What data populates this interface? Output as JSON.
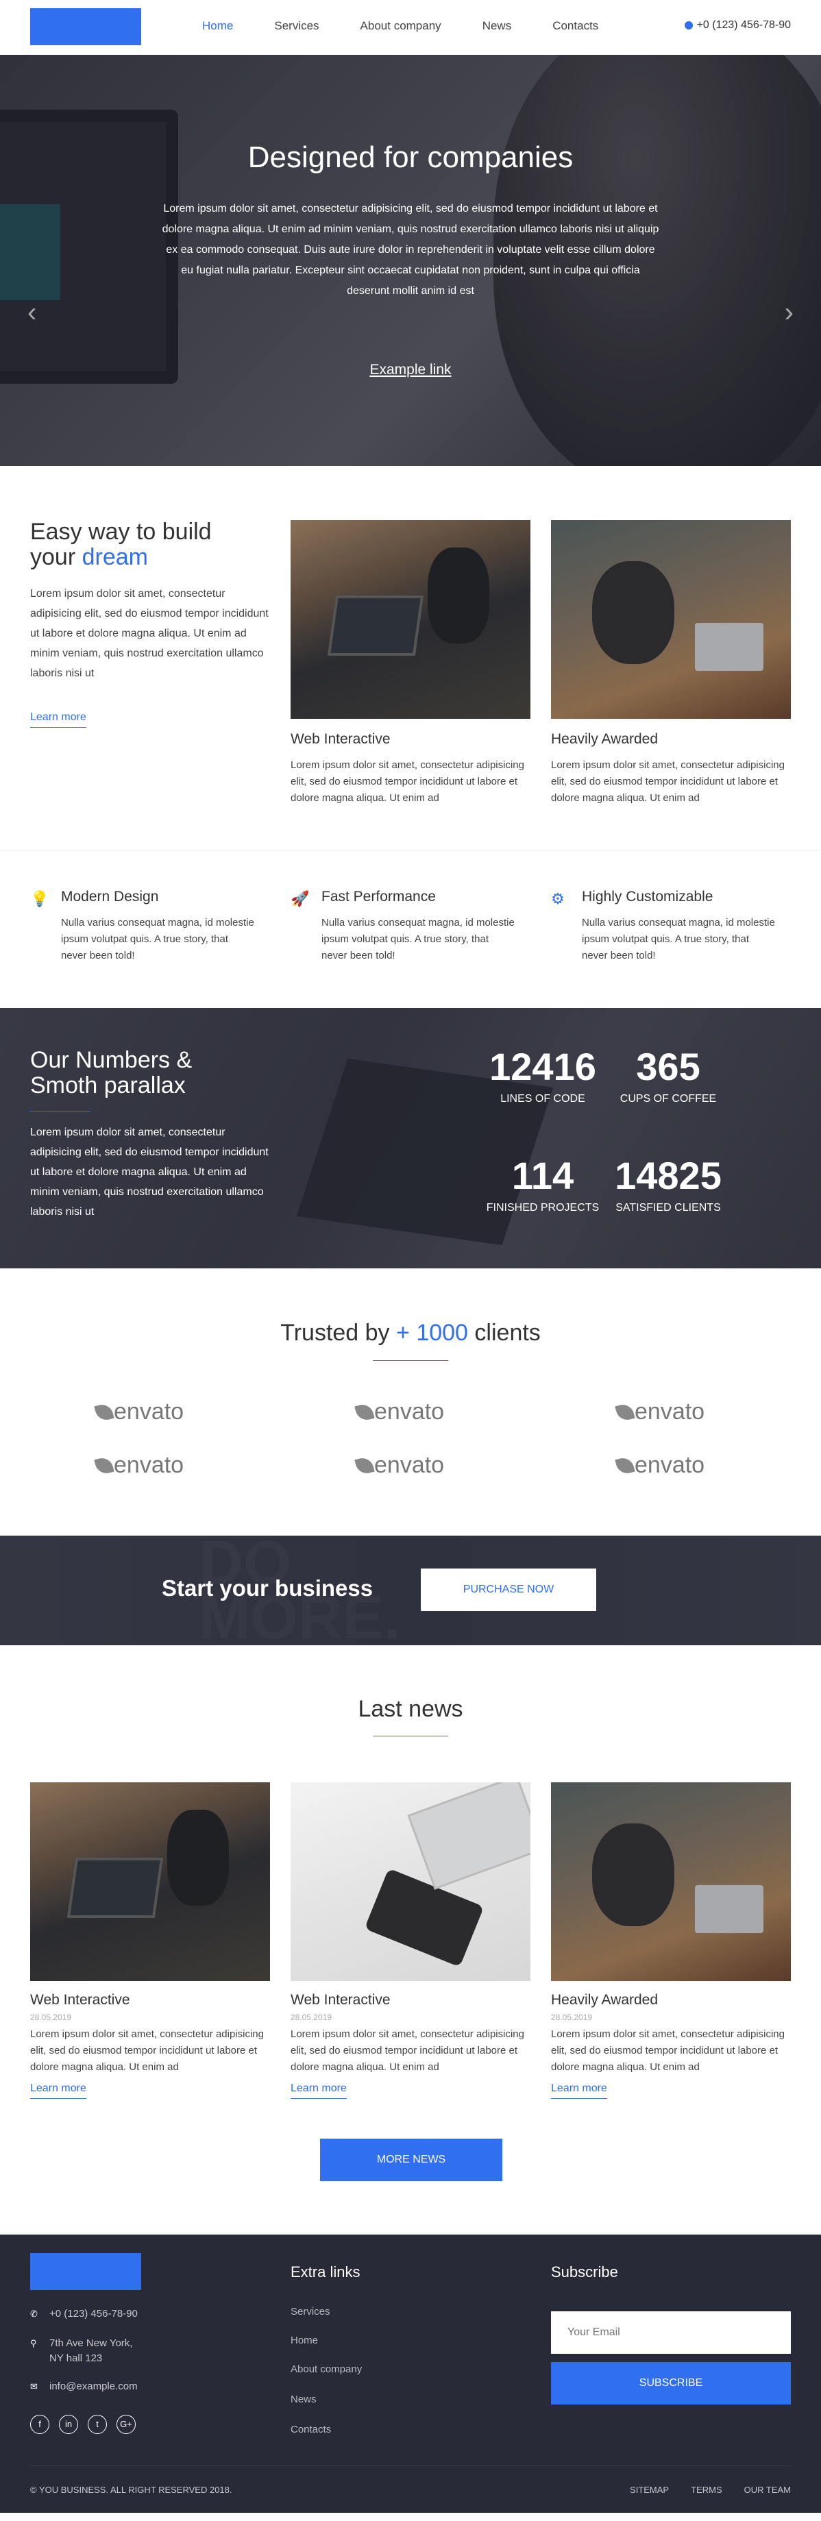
{
  "header": {
    "nav": [
      "Home",
      "Services",
      "About company",
      "News",
      "Contacts"
    ],
    "phone": "+0 (123) 456-78-90"
  },
  "hero": {
    "title": "Designed for companies",
    "text": "Lorem ipsum dolor sit amet, consectetur adipisicing elit, sed do eiusmod tempor incididunt ut labore et dolore magna aliqua. Ut enim ad minim veniam, quis nostrud exercitation ullamco laboris nisi ut aliquip ex ea commodo consequat. Duis aute irure dolor in reprehenderit in voluptate velit esse cillum dolore eu fugiat nulla pariatur. Excepteur sint occaecat cupidatat non proident, sunt in culpa qui officia deserunt mollit anim id est",
    "link": "Example link",
    "prev": "‹",
    "next": "›"
  },
  "intro": {
    "title_line1": "Easy way to build",
    "title_prefix": "your",
    "title_accent": "dream",
    "text": "Lorem ipsum dolor sit amet, consectetur adipisicing elit, sed do eiusmod tempor incididunt ut labore et dolore magna aliqua. Ut enim ad minim veniam, quis nostrud exercitation ullamco laboris nisi ut",
    "learn_more": "Learn more",
    "cards": [
      {
        "title": "Web Interactive",
        "text": "Lorem ipsum dolor sit amet, consectetur adipisicing elit, sed do eiusmod tempor incididunt ut labore et dolore magna aliqua. Ut enim ad"
      },
      {
        "title": "Heavily Awarded",
        "text": "Lorem ipsum dolor sit amet, consectetur adipisicing elit, sed do eiusmod tempor incididunt ut labore et dolore magna aliqua. Ut enim ad"
      }
    ]
  },
  "features": [
    {
      "icon": "lightbulb-icon",
      "glyph": "💡",
      "title": "Modern Design",
      "text": "Nulla varius consequat magna, id molestie ipsum volutpat quis. A true story, that never been told!"
    },
    {
      "icon": "rocket-icon",
      "glyph": "🚀",
      "title": "Fast Performance",
      "text": "Nulla varius consequat magna, id molestie ipsum volutpat quis. A true story, that never been told!"
    },
    {
      "icon": "gears-icon",
      "glyph": "⚙",
      "title": "Highly Customizable",
      "text": "Nulla varius consequat magna, id molestie ipsum volutpat quis. A true story, that never been told!"
    }
  ],
  "numbers": {
    "title_line1": "Our Numbers &",
    "title_line2": "Smoth parallax",
    "text": "Lorem ipsum dolor sit amet, consectetur adipisicing elit, sed do eiusmod tempor incididunt ut labore et dolore magna aliqua. Ut enim ad minim veniam, quis nostrud exercitation ullamco laboris nisi ut",
    "stats": [
      {
        "value": "12416",
        "label": "LINES OF CODE"
      },
      {
        "value": "365",
        "label": "CUPS OF COFFEE"
      },
      {
        "value": "114",
        "label": "FINISHED PROJECTS"
      },
      {
        "value": "14825",
        "label": "SATISFIED CLIENTS"
      }
    ]
  },
  "trusted": {
    "prefix": "Trusted by",
    "accent": "+ 1000",
    "suffix": "clients",
    "brands": [
      "envato",
      "envato",
      "envato",
      "envato",
      "envato",
      "envato"
    ]
  },
  "cta": {
    "bg_text_1": "DO",
    "bg_text_2": "MORE.",
    "title": "Start your business",
    "button": "PURCHASE NOW"
  },
  "news": {
    "title": "Last news",
    "items": [
      {
        "title": "Web Interactive",
        "date": "28.05.2019",
        "text": "Lorem ipsum dolor sit amet, consectetur adipisicing elit, sed do eiusmod tempor incididunt ut labore et dolore magna aliqua. Ut enim ad",
        "link": "Learn more"
      },
      {
        "title": "Web Interactive",
        "date": "28.05.2019",
        "text": "Lorem ipsum dolor sit amet, consectetur adipisicing elit, sed do eiusmod tempor incididunt ut labore et dolore magna aliqua. Ut enim ad",
        "link": "Learn more"
      },
      {
        "title": "Heavily Awarded",
        "date": "28.05.2019",
        "text": "Lorem ipsum dolor sit amet, consectetur adipisicing elit, sed do eiusmod tempor incididunt ut labore et dolore magna aliqua. Ut enim ad",
        "link": "Learn more"
      }
    ],
    "more_button": "MORE NEWS"
  },
  "footer": {
    "phone": "+0 (123) 456-78-90",
    "address_line1": "7th Ave New York,",
    "address_line2": "NY hall 123",
    "email": "info@example.com",
    "socials": [
      "f",
      "in",
      "t",
      "G+"
    ],
    "extra_links_title": "Extra links",
    "links": [
      "Services",
      "Home",
      "About company",
      "News",
      "Contacts"
    ],
    "subscribe_title": "Subscribe",
    "email_placeholder": "Your Email",
    "subscribe_button": "SUBSCRIBE",
    "copyright": "© YOU BUSINESS. ALL RIGHT RESERVED 2018.",
    "legal": [
      "SITEMAP",
      "TERMS",
      "OUR TEAM"
    ]
  },
  "colors": {
    "accent": "#2f6ff0",
    "footer_bg": "#282b37"
  }
}
